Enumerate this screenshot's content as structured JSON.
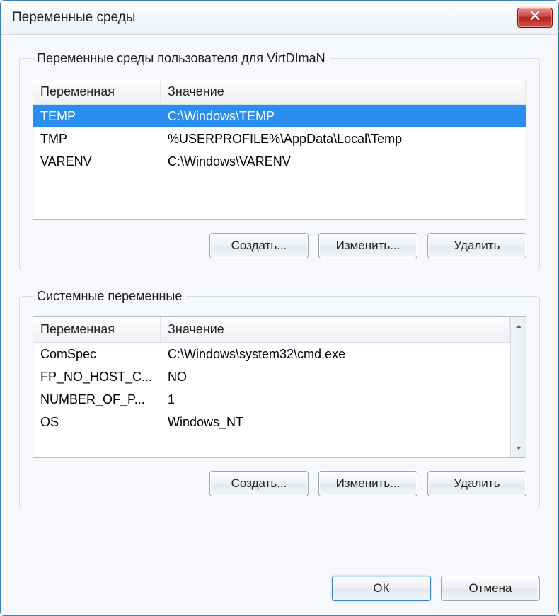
{
  "window": {
    "title": "Переменные среды"
  },
  "user_vars": {
    "legend": "Переменные среды пользователя для VirtDImaN",
    "columns": {
      "name": "Переменная",
      "value": "Значение"
    },
    "rows": [
      {
        "name": "TEMP",
        "value": "C:\\Windows\\TEMP",
        "selected": true
      },
      {
        "name": "TMP",
        "value": "%USERPROFILE%\\AppData\\Local\\Temp",
        "selected": false
      },
      {
        "name": "VARENV",
        "value": "C:\\Windows\\VARENV",
        "selected": false
      }
    ],
    "buttons": {
      "new": "Создать...",
      "edit": "Изменить...",
      "del": "Удалить"
    }
  },
  "sys_vars": {
    "legend": "Системные переменные",
    "columns": {
      "name": "Переменная",
      "value": "Значение"
    },
    "rows": [
      {
        "name": "ComSpec",
        "value": "C:\\Windows\\system32\\cmd.exe",
        "selected": false
      },
      {
        "name": "FP_NO_HOST_C...",
        "value": "NO",
        "selected": false
      },
      {
        "name": "NUMBER_OF_P...",
        "value": "1",
        "selected": false
      },
      {
        "name": "OS",
        "value": "Windows_NT",
        "selected": false
      }
    ],
    "buttons": {
      "new": "Создать...",
      "edit": "Изменить...",
      "del": "Удалить"
    },
    "has_scrollbar": true
  },
  "footer": {
    "ok": "ОК",
    "cancel": "Отмена"
  }
}
